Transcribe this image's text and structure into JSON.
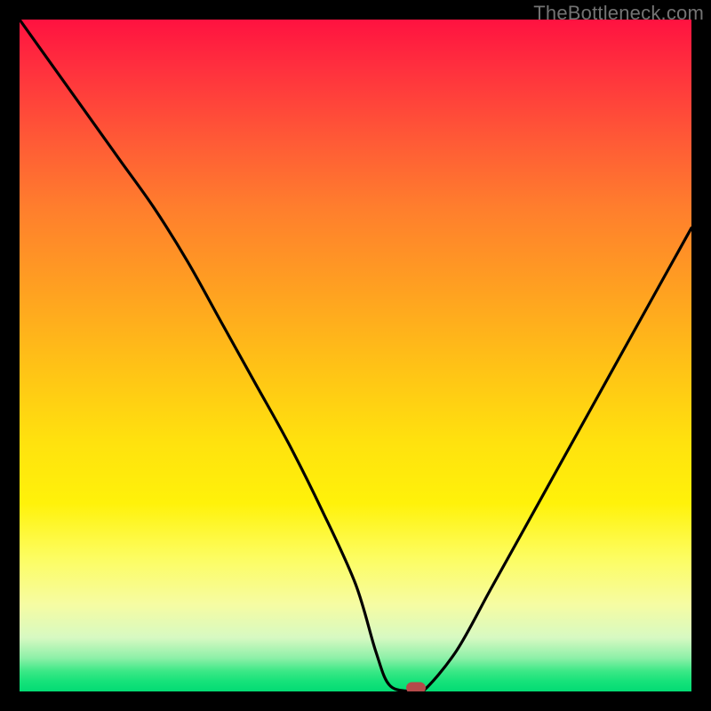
{
  "watermark": "TheBottleneck.com",
  "chart_data": {
    "type": "line",
    "title": "",
    "xlabel": "",
    "ylabel": "",
    "xlim": [
      0,
      100
    ],
    "ylim": [
      0,
      100
    ],
    "grid": false,
    "background": "rainbow-vertical-gradient",
    "series": [
      {
        "name": "bottleneck-curve",
        "color": "#000000",
        "x": [
          0,
          5,
          10,
          15,
          20,
          25,
          30,
          35,
          40,
          45,
          50,
          53,
          55,
          58,
          60,
          65,
          70,
          75,
          80,
          85,
          90,
          95,
          100
        ],
        "values": [
          100,
          93,
          86,
          79,
          72,
          64,
          55,
          46,
          37,
          27,
          16,
          6,
          1,
          0,
          0,
          6,
          15,
          24,
          33,
          42,
          51,
          60,
          69
        ]
      }
    ],
    "marker": {
      "x": 59,
      "y": 0.5,
      "color": "#b54a4a",
      "shape": "rounded-rect"
    }
  }
}
